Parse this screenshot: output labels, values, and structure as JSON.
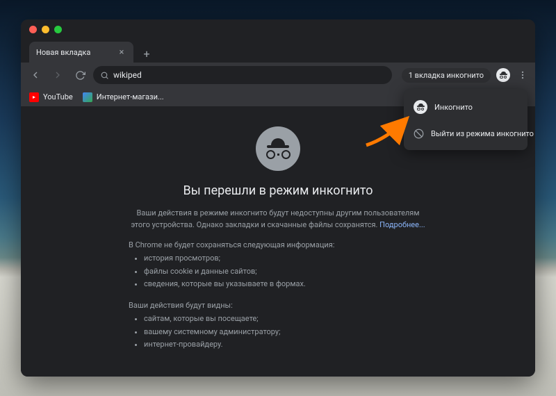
{
  "tab": {
    "title": "Новая вкладка"
  },
  "address": {
    "query": "wikiped"
  },
  "toolbar": {
    "incognito_badge": "1 вкладка инкогнито"
  },
  "bookmarks": [
    {
      "label": "YouTube"
    },
    {
      "label": "Интернет-магази..."
    }
  ],
  "main": {
    "heading": "Вы перешли в режим инкогнито",
    "description": "Ваши действия в режиме инкогнито будут недоступны другим пользователям этого устройства. Однако закладки и скачанные файлы сохранятся.",
    "learn_more": "Подробнее...",
    "not_saved_title": "В Chrome не будет сохраняться следующая информация:",
    "not_saved": [
      "история просмотров;",
      "файлы cookie и данные сайтов;",
      "сведения, которые вы указываете в формах."
    ],
    "visible_title": "Ваши действия будут видны:",
    "visible": [
      "сайтам, которые вы посещаете;",
      "вашему системному администратору;",
      "интернет-провайдеру."
    ]
  },
  "popup": {
    "profile": "Инкогнито",
    "exit": "Выйти из режима инкогнито"
  }
}
